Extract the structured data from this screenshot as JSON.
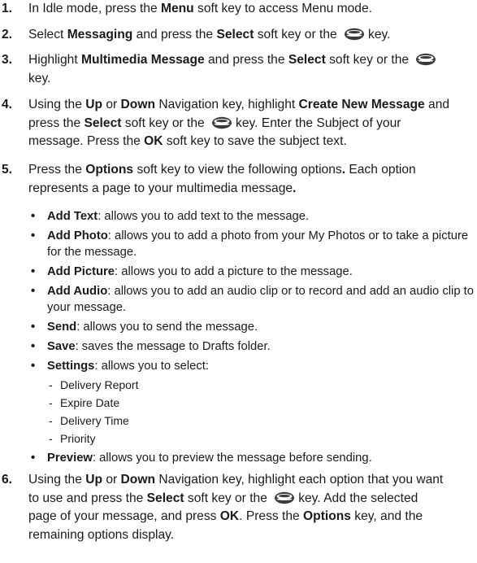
{
  "steps": [
    {
      "num": "1.",
      "parts": [
        "In Idle mode, press the ",
        "Menu",
        " soft key to access Menu mode."
      ]
    },
    {
      "num": "2.",
      "parts": [
        "Select ",
        "Messaging",
        " and press the ",
        "Select",
        " soft key or the ",
        "key."
      ]
    },
    {
      "num": "3.",
      "parts": [
        "Highlight ",
        "Multimedia Message",
        " and press the ",
        "Select",
        " soft key or the ",
        "key."
      ]
    },
    {
      "num": "4.",
      "parts": [
        "Using the ",
        "Up",
        " or ",
        "Down",
        " Navigation key, highlight ",
        "Create New Message",
        " and",
        "press the ",
        "Select",
        " soft key or the ",
        "key. Enter the Subject of your",
        "message. Press the ",
        "OK",
        " soft key to save the subject text."
      ]
    },
    {
      "num": "5.",
      "parts": [
        "Press the ",
        "Options",
        " soft key to view the following options",
        ".",
        " Each option",
        "represents a page to your multimedia message",
        "."
      ]
    },
    {
      "num": "6.",
      "parts": [
        "Using the ",
        "Up",
        " or ",
        "Down",
        " Navigation key, highlight each option that you want",
        "to use and press the ",
        "Select",
        " soft key or the ",
        "key.  Add the selected",
        "page of your message, and press ",
        "OK",
        ". Press the ",
        "Options",
        " key, and the",
        "remaining options display."
      ]
    }
  ],
  "options": [
    {
      "name": "Add Text",
      "desc": ": allows you to add text to the message."
    },
    {
      "name": "Add Photo",
      "desc": ": allows you to add a photo from your My Photos or to take a picture",
      "desc2": "for the message."
    },
    {
      "name": "Add Picture",
      "desc": ": allows you to add a picture to the message."
    },
    {
      "name": "Add Audio",
      "desc": ": allows you to add an audio clip or to record and add an audio clip to",
      "desc2": "your message."
    },
    {
      "name": "Send",
      "desc": ": allows you to send the message."
    },
    {
      "name": "Save",
      "desc": ": saves the message to Drafts folder."
    },
    {
      "name": "Settings",
      "desc": ": allows you to select:"
    },
    {
      "name": "Preview",
      "desc": ": allows you to preview the message before sending."
    }
  ],
  "settings_items": [
    "Delivery Report",
    "Expire Date",
    "Delivery Time",
    "Priority"
  ],
  "bullet": "•",
  "dash": "-",
  "icon": "ok-key-icon"
}
